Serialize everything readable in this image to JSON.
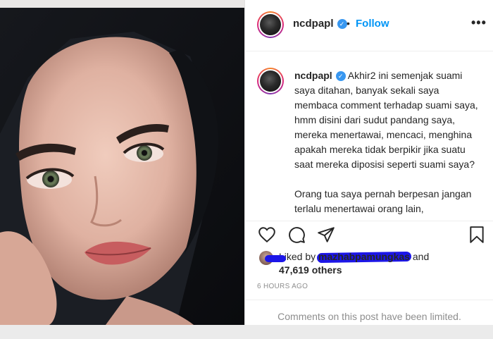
{
  "post": {
    "username": "ncdpapl",
    "follow_label": "Follow",
    "separator": "•",
    "more_label": "•••"
  },
  "caption": {
    "username": "ncdpapl",
    "paragraph1": "Akhir2 ini semenjak suami saya ditahan, banyak sekali saya membaca comment terhadap suami saya, hmm disini dari sudut pandang saya, mereka menertawai, mencaci, menghina apakah mereka tidak berpikir jika suatu saat mereka diposisi seperti suami saya?",
    "paragraph2": "Orang tua saya pernah berpesan jangan terlalu menertawai orang lain,"
  },
  "likes": {
    "prefix": "Liked by",
    "liker": "mazhabpamungkas",
    "joiner": "and",
    "count": "47,619 others"
  },
  "timestamp": "6 HOURS AGO",
  "comments_notice": "Comments on this post have been limited.",
  "icons": {
    "verified": "verified-badge-icon",
    "like": "heart-icon",
    "comment": "comment-bubble-icon",
    "share": "paper-plane-icon",
    "save": "bookmark-icon"
  },
  "colors": {
    "follow": "#0095f6",
    "verified": "#3897f0",
    "redaction": "#1c16e8",
    "muted": "#8e8e8e"
  }
}
